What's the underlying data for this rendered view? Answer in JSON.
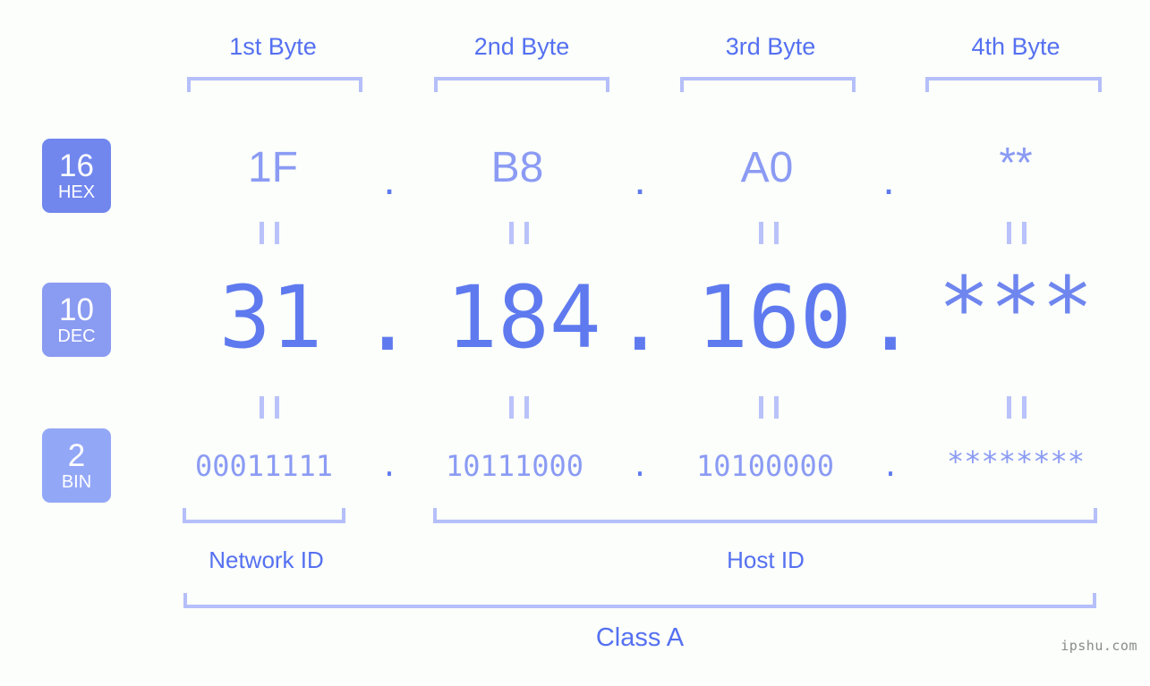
{
  "page": {
    "background_color": "#fbfefa",
    "accent_color": "#5570f1",
    "light_accent_color": "#b5bffa",
    "value_color": "#8b9bf4",
    "dec_color": "#5f7aef",
    "watermark": "ipshu.com"
  },
  "byte_headers": [
    {
      "label": "1st Byte"
    },
    {
      "label": "2nd Byte"
    },
    {
      "label": "3rd Byte"
    },
    {
      "label": "4th Byte"
    }
  ],
  "bases": [
    {
      "number": "16",
      "name": "HEX",
      "color": "#7187ee"
    },
    {
      "number": "10",
      "name": "DEC",
      "color": "#8a9bf2"
    },
    {
      "number": "2",
      "name": "BIN",
      "color": "#93a7f7"
    }
  ],
  "rows": {
    "hex": {
      "base_number": "16",
      "base_name": "HEX",
      "values": [
        "1F",
        "B8",
        "A0",
        "**"
      ],
      "separator": "."
    },
    "dec": {
      "base_number": "10",
      "base_name": "DEC",
      "values": [
        "31",
        "184",
        "160",
        "***"
      ],
      "separator": "."
    },
    "bin": {
      "base_number": "2",
      "base_name": "BIN",
      "values": [
        "00011111",
        "10111000",
        "10100000",
        "********"
      ],
      "separator": "."
    }
  },
  "equals_marker": "||",
  "id_labels": {
    "network": "Network ID",
    "host": "Host ID"
  },
  "class_label": "Class A"
}
